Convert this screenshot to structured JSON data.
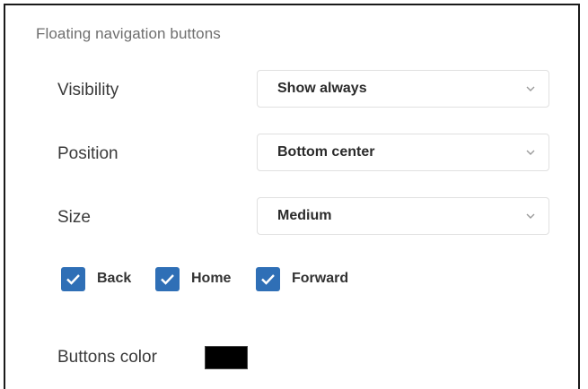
{
  "section": {
    "title": "Floating navigation buttons"
  },
  "settings": [
    {
      "label": "Visibility",
      "value": "Show always"
    },
    {
      "label": "Position",
      "value": "Bottom center"
    },
    {
      "label": "Size",
      "value": "Medium"
    }
  ],
  "checkboxes": [
    {
      "label": "Back",
      "checked": true
    },
    {
      "label": "Home",
      "checked": true
    },
    {
      "label": "Forward",
      "checked": true
    }
  ],
  "color_setting": {
    "label": "Buttons color",
    "value": "#000000"
  },
  "theme": {
    "accent": "#2f6fb6",
    "icons": [
      "chevron-down-icon",
      "checkmark-icon"
    ]
  }
}
